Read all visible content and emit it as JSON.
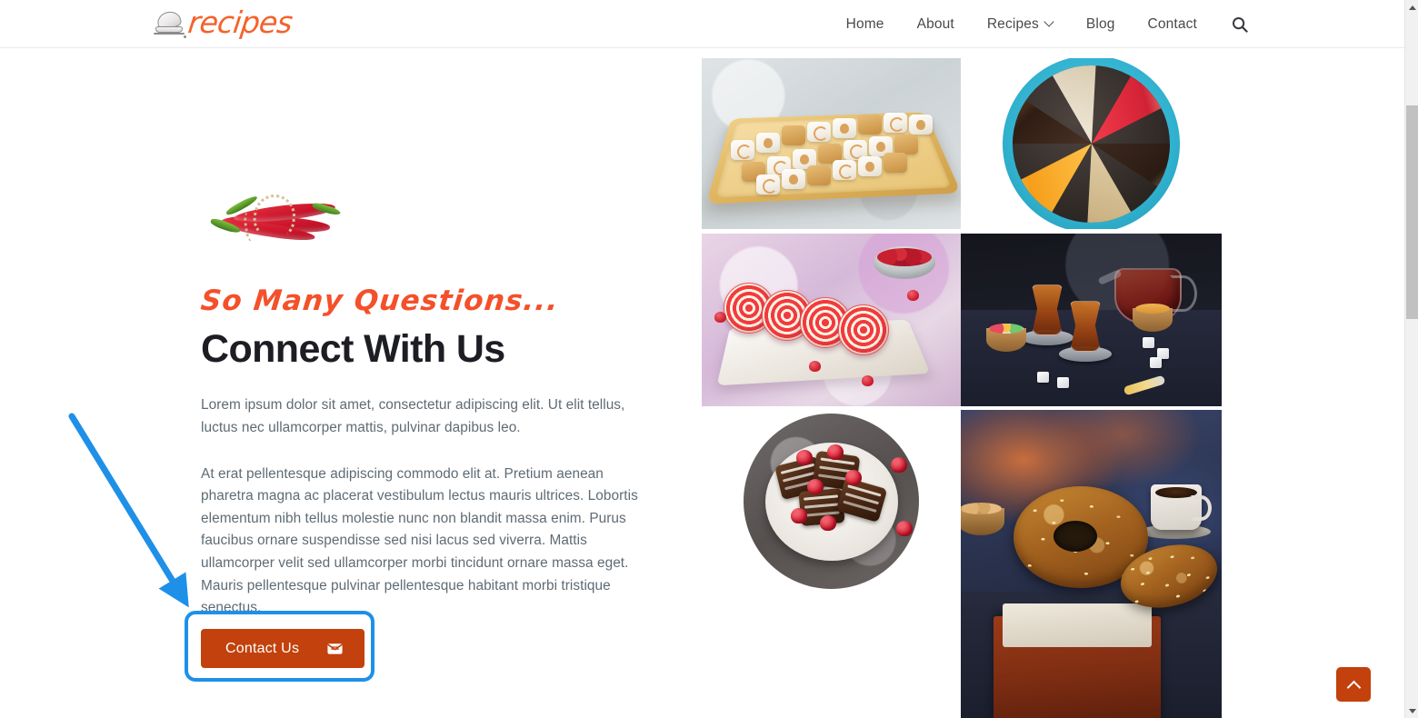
{
  "header": {
    "brand": {
      "text": "recipes",
      "icon": "chef-hat-icon",
      "color": "#f4632a"
    },
    "nav": [
      {
        "label": "Home",
        "has_dropdown": false
      },
      {
        "label": "About",
        "has_dropdown": false
      },
      {
        "label": "Recipes",
        "has_dropdown": true
      },
      {
        "label": "Blog",
        "has_dropdown": false
      },
      {
        "label": "Contact",
        "has_dropdown": false
      }
    ],
    "search_icon": "search-icon"
  },
  "main": {
    "decor_image_alt": "red chili peppers tied with twine",
    "eyebrow": "So Many Questions...",
    "headline": "Connect With Us",
    "paragraphs": [
      "Lorem ipsum dolor sit amet, consectetur adipiscing elit. Ut elit tellus, luctus nec ullamcorper mattis, pulvinar dapibus leo.",
      "At erat pellentesque adipiscing commodo elit at. Pretium aenean pharetra magna ac placerat vestibulum lectus mauris ultrices. Lobortis elementum nibh tellus molestie nunc non blandit massa enim. Purus faucibus ornare suspendisse sed nisi lacus sed viverra. Mattis ullamcorper velit sed ullamcorper morbi tincidunt ornare massa eget. Mauris pellentesque pulvinar pellentesque habitant morbi tristique senectus."
    ],
    "cta": {
      "label": "Contact Us",
      "icon": "envelope-icon",
      "background": "#c2410c",
      "text_color": "#ffffff"
    }
  },
  "gallery": {
    "items": [
      {
        "alt": "Turkish delight sweets on a wooden tray",
        "shape": "rectangle"
      },
      {
        "alt": "Assorted cake slices arranged on a dark plate",
        "shape": "circle"
      },
      {
        "alt": "Red and white spiral roll cake slices with raspberries",
        "shape": "rectangle"
      },
      {
        "alt": "Turkish tea glasses with teapot and sugar cubes",
        "shape": "rectangle"
      },
      {
        "alt": "Chocolate crepes with white drizzle and raspberries",
        "shape": "circle"
      },
      {
        "alt": "Sesame simit bread in a wooden crate with coffee",
        "shape": "rectangle"
      }
    ]
  },
  "annotations": {
    "arrow": {
      "color": "#1e90e8",
      "points_to": "contact-us-button"
    },
    "highlight_box": {
      "color": "#1e90e8",
      "target": "contact-us-button"
    }
  },
  "back_to_top": {
    "icon": "chevron-up-icon",
    "background": "#c2410c"
  },
  "scrollbar": {
    "up_icon": "scroll-up-arrow-icon",
    "down_icon": "scroll-down-arrow-icon"
  }
}
